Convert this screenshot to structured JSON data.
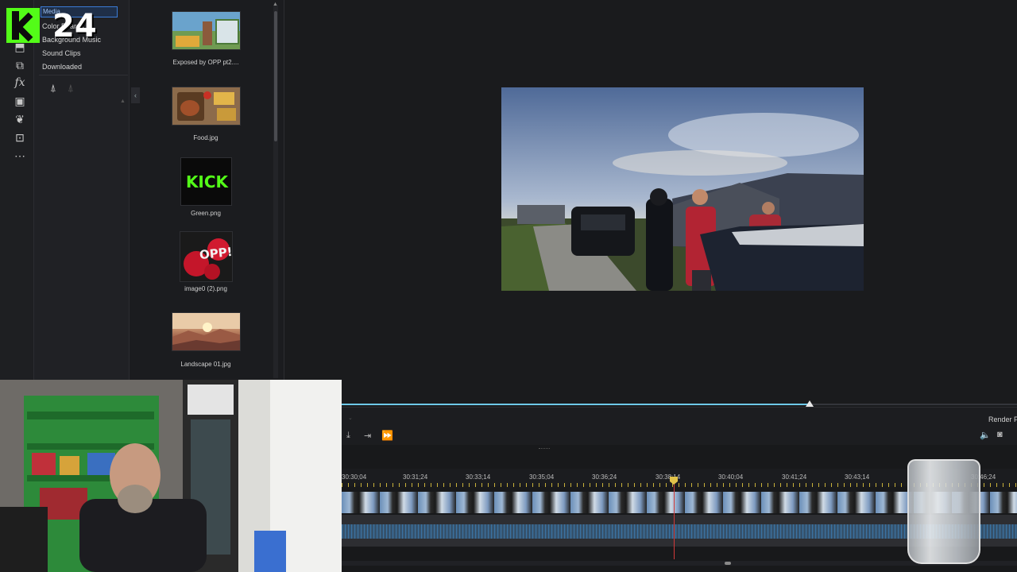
{
  "overlay_logo": {
    "number": "24"
  },
  "categories": {
    "items": [
      {
        "label": "Media"
      },
      {
        "label": "Color Boards"
      },
      {
        "label": "Background Music"
      },
      {
        "label": "Sound Clips"
      },
      {
        "label": "Downloaded"
      }
    ]
  },
  "library": {
    "items": [
      {
        "caption": "Exposed by OPP pt2...."
      },
      {
        "caption": "Food.jpg"
      },
      {
        "caption": "Green.png",
        "art_text": "KICK"
      },
      {
        "caption": "image0 (2).png",
        "art_text": "OPP!"
      },
      {
        "caption": "Landscape 01.jpg"
      }
    ]
  },
  "playback": {
    "progress": 0.693
  },
  "controls": {
    "render_label": "Render Pr"
  },
  "timeline": {
    "ruler_labels": [
      "30:30;04",
      "30:31;24",
      "30:33;14",
      "30:35;04",
      "30:36;24",
      "30:38;14",
      "30:40;04",
      "30:41;24",
      "30:43;14",
      "30:46;24"
    ]
  },
  "colors": {
    "accent_blue": "#6ec9e8",
    "selection_blue": "#3a7bd5",
    "playhead_red": "#d23a3a",
    "kick_green": "#53fc18"
  }
}
